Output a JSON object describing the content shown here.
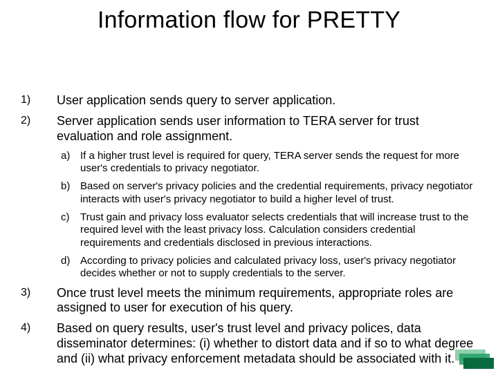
{
  "title": "Information flow for PRETTY",
  "items": [
    {
      "marker": "1)",
      "text": "User application sends query to server application."
    },
    {
      "marker": "2)",
      "text": "Server application sends user information to TERA server for trust evaluation and role assignment.",
      "sub": [
        {
          "marker": "a)",
          "text": "If a higher trust level is required for query, TERA server sends the request for more user's credentials to privacy negotiator."
        },
        {
          "marker": "b)",
          "text": "Based on server's privacy policies and the credential requirements, privacy negotiator interacts with user's privacy negotiator to build a higher level of trust."
        },
        {
          "marker": "c)",
          "text": "Trust gain and privacy loss evaluator selects credentials that will increase trust to the required level with the least privacy loss. Calculation considers credential requirements and credentials disclosed in previous interactions."
        },
        {
          "marker": "d)",
          "text": "According to privacy policies and calculated privacy loss, user's privacy negotiator decides whether or not to supply credentials to the server."
        }
      ]
    },
    {
      "marker": "3)",
      "text": "Once trust level meets the minimum requirements, appropriate roles are assigned to user for execution of his query."
    },
    {
      "marker": "4)",
      "text": "Based on query results, user's trust level and privacy polices, data disseminator determines: (i) whether to distort data and if so to what degree and (ii) what privacy enforcement metadata should be associated with it."
    }
  ]
}
